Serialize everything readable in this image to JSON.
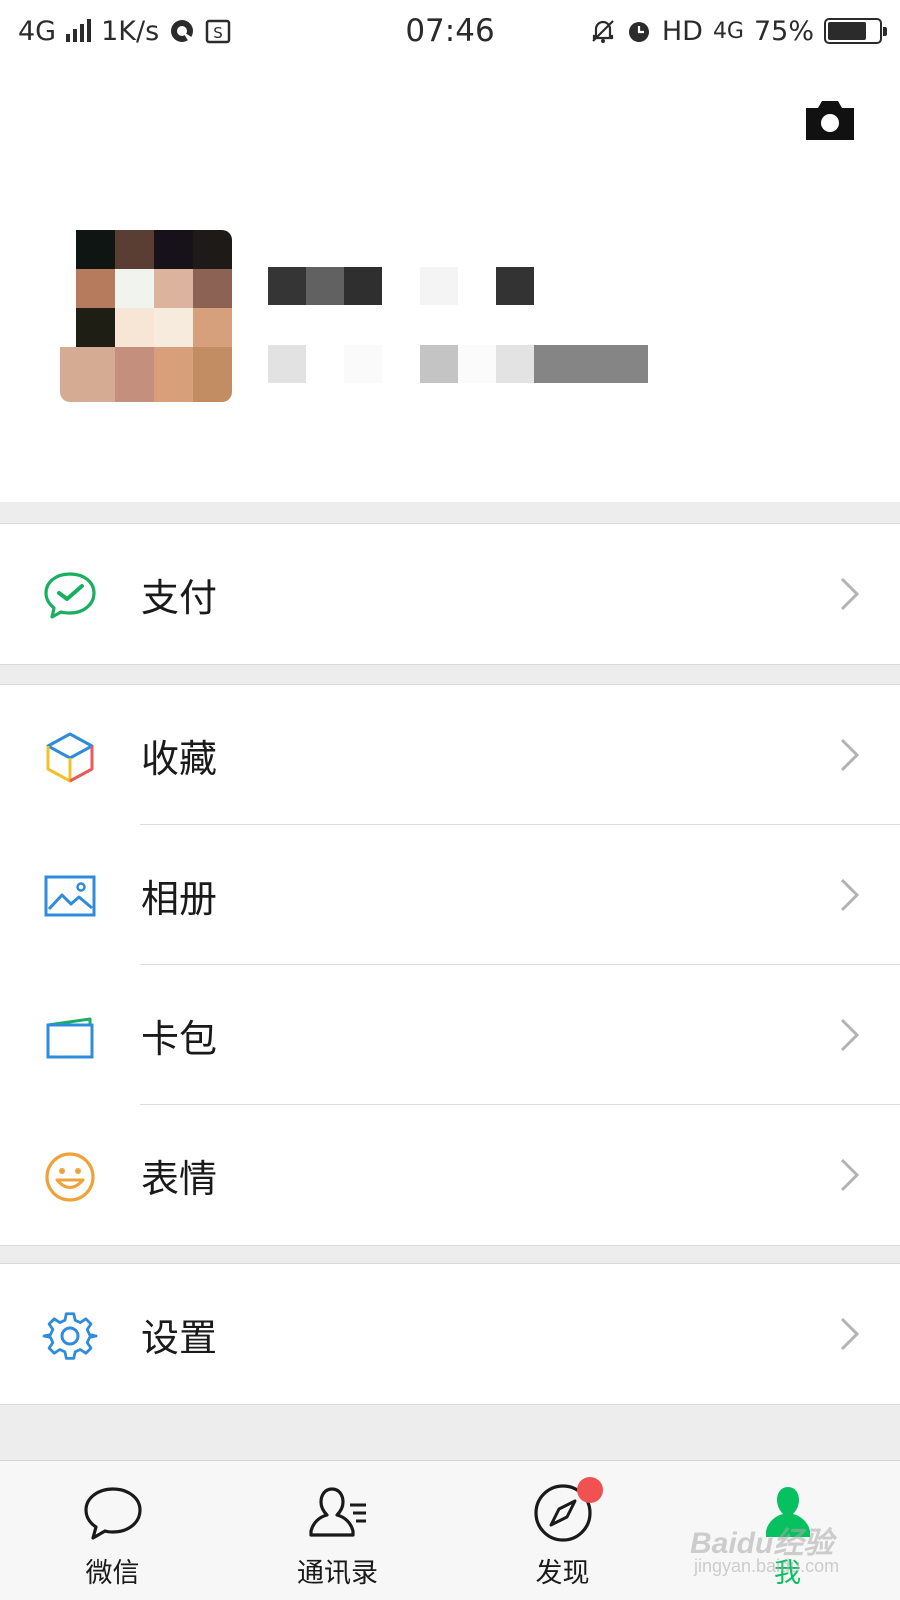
{
  "status_bar": {
    "network": "4G",
    "speed": "1K/s",
    "time": "07:46",
    "hd": "HD",
    "network_right": "4G",
    "battery": "75%",
    "battery_level": 0.75
  },
  "profile": {
    "camera_icon": "camera-icon",
    "avatar": "avatar"
  },
  "menu": {
    "pay": {
      "label": "支付",
      "icon": "wechat-pay-icon"
    },
    "favorites": {
      "label": "收藏",
      "icon": "cube-icon"
    },
    "album": {
      "label": "相册",
      "icon": "picture-icon"
    },
    "cards": {
      "label": "卡包",
      "icon": "wallet-icon"
    },
    "stickers": {
      "label": "表情",
      "icon": "smiley-icon"
    },
    "settings": {
      "label": "设置",
      "icon": "gear-icon"
    }
  },
  "tabs": [
    {
      "label": "微信",
      "icon": "chat-icon",
      "active": false
    },
    {
      "label": "通讯录",
      "icon": "contacts-icon",
      "active": false
    },
    {
      "label": "发现",
      "icon": "compass-icon",
      "active": false,
      "badge": true
    },
    {
      "label": "我",
      "icon": "me-icon",
      "active": true
    }
  ],
  "watermark": {
    "brand": "Baidu经验",
    "url": "jingyan.baidu.com"
  },
  "colors": {
    "accent_green": "#07c160",
    "badge_red": "#f25151",
    "background": "#ededed",
    "card": "#ffffff"
  }
}
